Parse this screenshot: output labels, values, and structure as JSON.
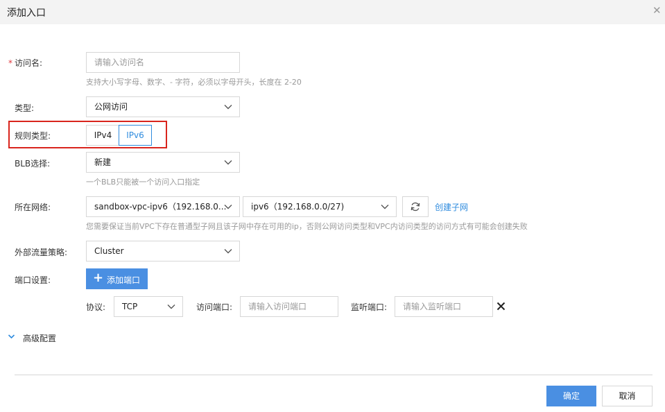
{
  "dialog": {
    "title": "添加入口"
  },
  "form": {
    "access_name": {
      "required_mark": "*",
      "label": "访问名:",
      "placeholder": "请输入访问名",
      "hint": "支持大小写字母、数字、- 字符，必须以字母开头，长度在 2-20"
    },
    "type": {
      "label": "类型:",
      "value": "公网访问"
    },
    "rule_type": {
      "label": "规则类型:",
      "options": [
        "IPv4",
        "IPv6"
      ],
      "selected": "IPv6"
    },
    "blb": {
      "label": "BLB选择:",
      "value": "新建",
      "hint": "一个BLB只能被一个访问入口指定"
    },
    "network": {
      "label": "所在网络:",
      "vpc_value": "sandbox-vpc-ipv6（192.168.0...",
      "subnet_value": "ipv6（192.168.0.0/27)",
      "create_subnet_link": "创建子网",
      "hint": "您需要保证当前VPC下存在普通型子网且该子网中存在可用的ip，否则公网访问类型和VPC内访问类型的访问方式有可能会创建失败"
    },
    "traffic_policy": {
      "label": "外部流量策略:",
      "value": "Cluster"
    },
    "ports": {
      "label": "端口设置:",
      "add_button": "添加端口",
      "protocol_label": "协议:",
      "protocol_value": "TCP",
      "access_port_label": "访问端口:",
      "access_port_placeholder": "请输入访问端口",
      "listen_port_label": "监听端口:",
      "listen_port_placeholder": "请输入监听端口"
    },
    "advanced": {
      "label": "高级配置"
    }
  },
  "footer": {
    "confirm": "确定",
    "cancel": "取消"
  },
  "colors": {
    "accent": "#2e8bde",
    "primary_button": "#4a8fe2",
    "highlight_box": "#d9241c",
    "required": "#e0393e"
  }
}
